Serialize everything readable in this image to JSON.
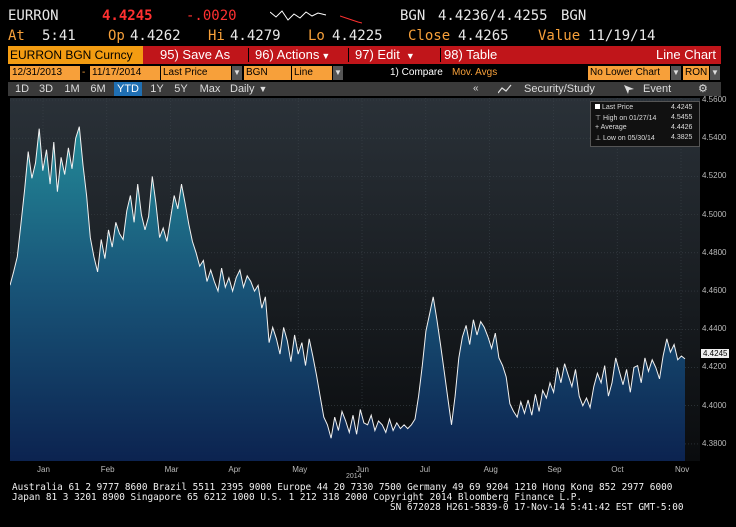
{
  "quote": {
    "ticker": "EURRON",
    "last": "4.4245",
    "change": "-.0020",
    "bid_ask_ccy": "BGN",
    "bid_ask": "4.4236/4.4255",
    "bid_ask_ccy2": "BGN",
    "at_label": "At",
    "at_time": "5:41",
    "op_label": "Op",
    "op": "4.4262",
    "hi_label": "Hi",
    "hi": "4.4279",
    "lo_label": "Lo",
    "lo": "4.4225",
    "close_label": "Close",
    "close": "4.4265",
    "value_label": "Value",
    "value_date": "11/19/14"
  },
  "toolbar": {
    "title": "EURRON BGN Curncy",
    "save_label": "95) Save As",
    "actions_label": "96) Actions",
    "edit_label": "97) Edit",
    "table_label": "98) Table",
    "chart_type": "Line Chart"
  },
  "controls": {
    "start_date": "12/31/2013",
    "end_date": "11/17/2014",
    "field": "Last Price",
    "currency": "BGN",
    "style": "Line",
    "compare": "1) Compare",
    "mov_avgs": "Mov. Avgs",
    "lower_chart": "No Lower Chart",
    "unit": "RON"
  },
  "ranges": {
    "items": [
      "1D",
      "3D",
      "1M",
      "6M",
      "YTD",
      "1Y",
      "5Y",
      "Max"
    ],
    "active": "YTD",
    "period": "Daily",
    "security_study": "Security/Study",
    "event": "Event"
  },
  "legend": {
    "last_price": "Last Price",
    "last_value": "4.4245",
    "high": "High on 01/27/14",
    "high_value": "4.5455",
    "average": "Average",
    "average_value": "4.4426",
    "low": "Low on 05/30/14",
    "low_value": "4.3825"
  },
  "colors": {
    "orange": "#f7a03a",
    "red_bar": "#c0151a",
    "change_red": "#ff3030",
    "active_tab": "#1f6fb3"
  },
  "chart_data": {
    "type": "area",
    "series": [
      {
        "values": [
          4.463,
          4.47,
          4.478,
          4.495,
          4.513,
          4.533,
          4.519,
          4.527,
          4.545,
          4.523,
          4.534,
          4.516,
          4.538,
          4.512,
          4.53,
          4.521,
          4.535,
          4.524,
          4.54,
          4.546,
          4.526,
          4.51,
          4.488,
          4.478,
          4.47,
          4.487,
          4.477,
          4.492,
          4.483,
          4.496,
          4.49,
          4.487,
          4.502,
          4.51,
          4.496,
          4.516,
          4.5,
          4.492,
          4.499,
          4.52,
          4.506,
          4.488,
          4.493,
          4.486,
          4.498,
          4.51,
          4.503,
          4.516,
          4.506,
          4.495,
          4.486,
          4.48,
          4.473,
          4.476,
          4.465,
          4.471,
          4.465,
          4.46,
          4.472,
          4.462,
          4.467,
          4.46,
          4.467,
          4.471,
          4.462,
          4.468,
          4.465,
          4.46,
          4.463,
          4.451,
          4.457,
          4.433,
          4.441,
          4.435,
          4.427,
          4.441,
          4.434,
          4.423,
          4.437,
          4.427,
          4.433,
          4.421,
          4.435,
          4.426,
          4.416,
          4.405,
          4.394,
          4.39,
          4.383,
          4.394,
          4.387,
          4.397,
          4.392,
          4.386,
          4.395,
          4.385,
          4.398,
          4.391,
          4.39,
          4.395,
          4.387,
          4.392,
          4.39,
          4.386,
          4.393,
          4.387,
          4.391,
          4.388,
          4.39,
          4.388,
          4.39,
          4.393,
          4.405,
          4.421,
          4.439,
          4.448,
          4.457,
          4.445,
          4.432,
          4.418,
          4.404,
          4.39,
          4.405,
          4.425,
          4.436,
          4.442,
          4.432,
          4.445,
          4.437,
          4.444,
          4.441,
          4.436,
          4.43,
          4.438,
          4.425,
          4.421,
          4.415,
          4.401,
          4.397,
          4.394,
          4.402,
          4.396,
          4.403,
          4.395,
          4.406,
          4.397,
          4.408,
          4.404,
          4.412,
          4.407,
          4.42,
          4.412,
          4.422,
          4.416,
          4.41,
          4.419,
          4.405,
          4.4,
          4.404,
          4.399,
          4.41,
          4.417,
          4.412,
          4.421,
          4.405,
          4.412,
          4.425,
          4.418,
          4.411,
          4.419,
          4.407,
          4.42,
          4.421,
          4.412,
          4.425,
          4.418,
          4.424,
          4.42,
          4.414,
          4.426,
          4.435,
          4.428,
          4.432,
          4.424,
          4.426,
          4.4245
        ]
      }
    ],
    "x_tick_labels": [
      "Jan",
      "Feb",
      "Mar",
      "Apr",
      "May",
      "Jun",
      "Jul",
      "Aug",
      "Sep",
      "Oct",
      "Nov"
    ],
    "year_label": "2014",
    "y_tick_labels": [
      "4.5600",
      "4.5400",
      "4.5200",
      "4.5000",
      "4.4800",
      "4.4600",
      "4.4400",
      "4.4200",
      "4.4000",
      "4.3800"
    ],
    "ylim": [
      4.37,
      4.56
    ],
    "last_label": "4.4245",
    "legend_placement": "top-right"
  },
  "footer": {
    "line1": "Australia 61 2 9777 8600 Brazil 5511 2395 9000 Europe 44 20 7330 7500 Germany 49 69 9204 1210 Hong Kong 852 2977 6000",
    "line2": "Japan 81 3 3201 8900         Singapore 65 6212 1000         U.S. 1 212 318 2000         Copyright 2014 Bloomberg Finance L.P.",
    "line3": "SN 672028 H261-5839-0 17-Nov-14  5:41:42 EST  GMT-5:00"
  }
}
